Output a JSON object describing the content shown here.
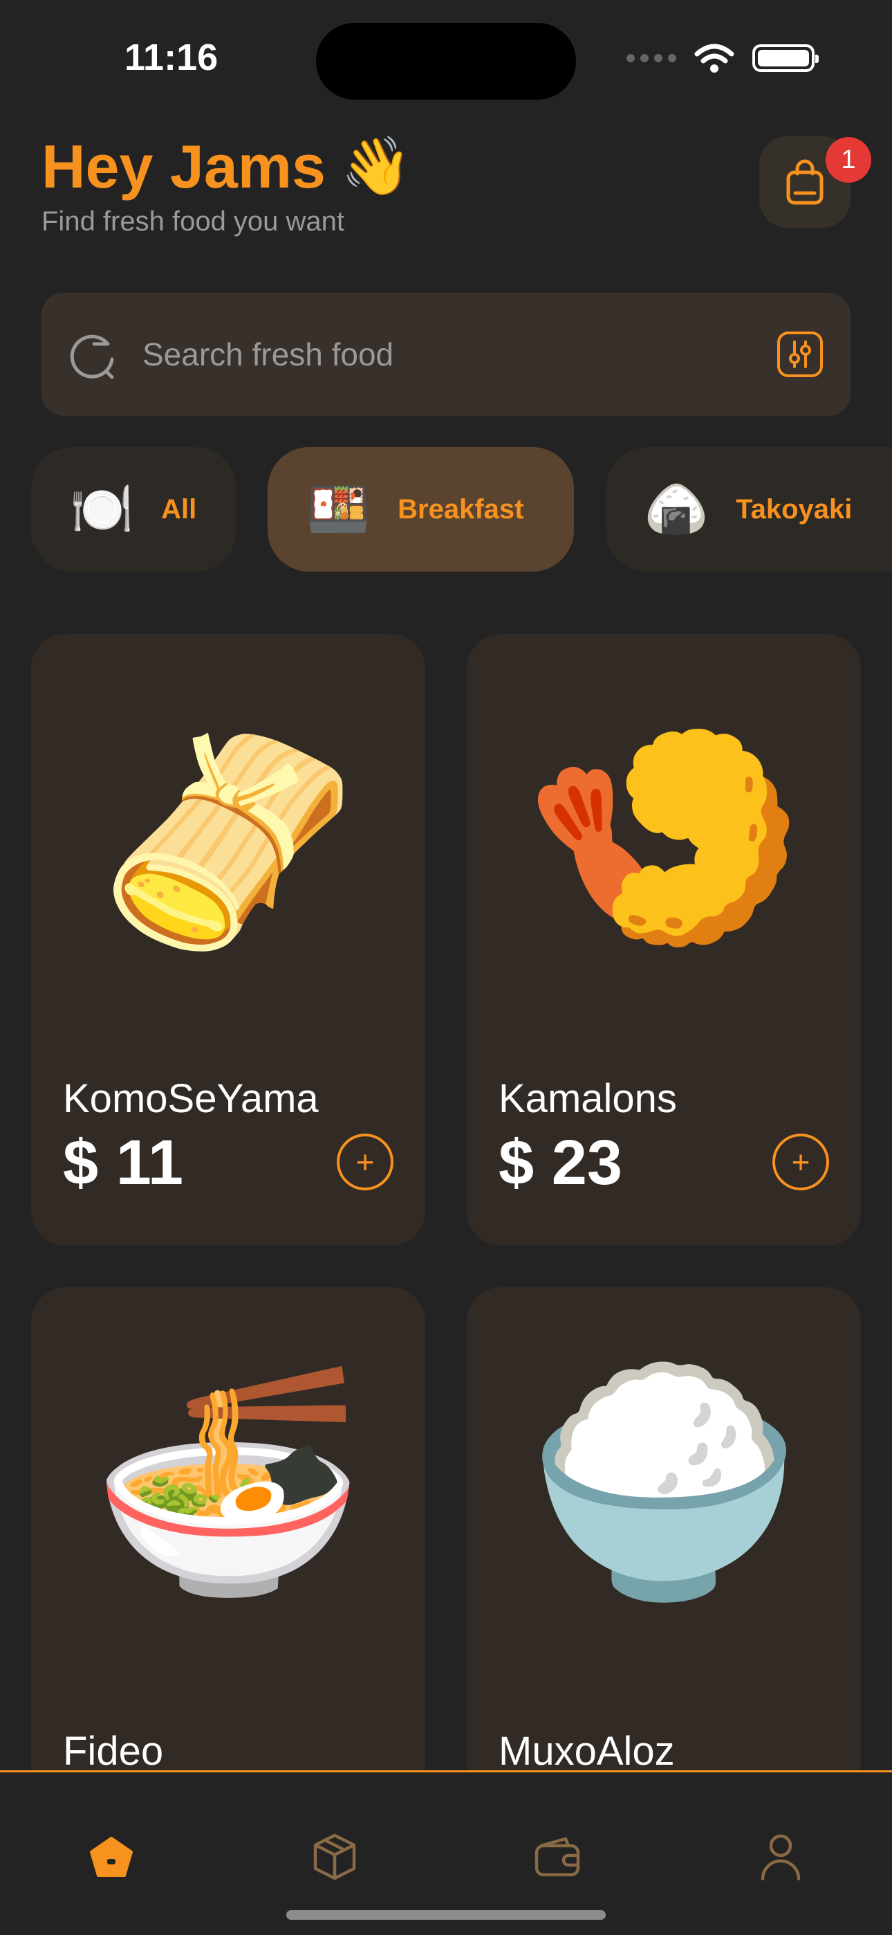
{
  "status_bar": {
    "time": "11:16"
  },
  "header": {
    "greeting": "Hey Jams",
    "wave_emoji": "👋",
    "subtitle": "Find fresh food you want",
    "cart_badge": "1"
  },
  "search": {
    "placeholder": "Search fresh food"
  },
  "categories": [
    {
      "label": "All",
      "emoji": "🍽️",
      "active": false
    },
    {
      "label": "Breakfast",
      "emoji": "🍱",
      "active": true
    },
    {
      "label": "Takoyaki",
      "emoji": "🍙",
      "active": false
    }
  ],
  "products": [
    {
      "name": "KomoSeYama",
      "price": "$ 11",
      "emoji": "🫔"
    },
    {
      "name": "Kamalons",
      "price": "$ 23",
      "emoji": "🍤"
    },
    {
      "name": "Fideo",
      "emoji": "🍜"
    },
    {
      "name": "MuxoAloz",
      "emoji": "🍚"
    }
  ],
  "bottom_nav": [
    {
      "icon": "home-icon",
      "active": true
    },
    {
      "icon": "box-icon",
      "active": false
    },
    {
      "icon": "wallet-icon",
      "active": false
    },
    {
      "icon": "profile-icon",
      "active": false
    }
  ],
  "colors": {
    "accent": "#f7921e",
    "background": "#232323",
    "card": "#322a25",
    "badge": "#e53935"
  }
}
